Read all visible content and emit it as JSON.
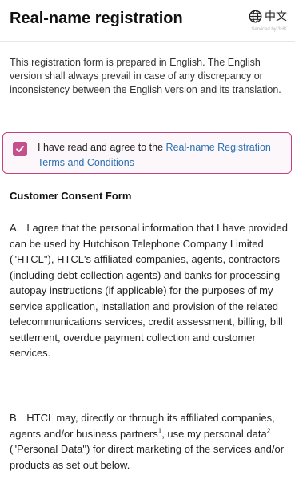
{
  "header": {
    "title": "Real-name registration",
    "lang_label": "中文",
    "serviced_by": "Serviced by 3HK"
  },
  "notice": {
    "text": "This registration form is prepared in English. The English version shall always prevail in case of any discrepancy or inconsistency between the English version and its translation."
  },
  "agree": {
    "checked": true,
    "text": "I have read and agree to the ",
    "link": "Real-name Registration Terms and Conditions"
  },
  "consent": {
    "title": "Customer Consent Form",
    "para_a_label": "A.",
    "para_a": "I agree that the personal information that I have provided can be used by Hutchison Telephone Company Limited (\"HTCL\"), HTCL's affiliated companies, agents, contractors (including debt collection agents) and banks for processing autopay instructions (if applicable) for the purposes of my service application, installation and provision of the related telecommunications services, credit assessment, billing, bill settlement, overdue payment collection and customer services.",
    "para_b_label": "B.",
    "para_b_1": "HTCL may, directly or through its affiliated companies, agents and/or business partners",
    "para_b_sup1": "1",
    "para_b_2": ", use my personal data",
    "para_b_sup2": "2",
    "para_b_3": " (\"Personal Data\") for direct marketing of the services and/or products as set out below."
  },
  "colors": {
    "accent": "#c4518b",
    "link": "#2a6fb0",
    "border_accent": "#c2427f"
  }
}
